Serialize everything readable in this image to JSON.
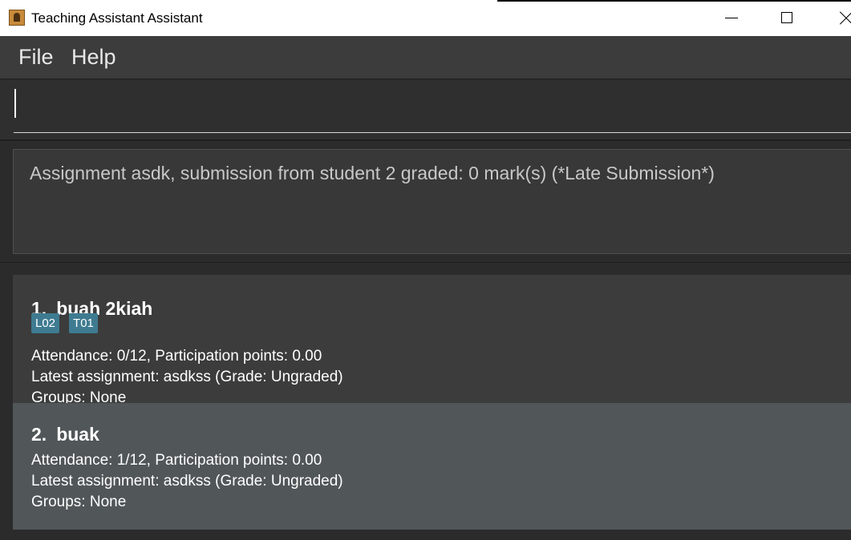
{
  "window": {
    "title": "Teaching Assistant Assistant",
    "icon": "person-icon"
  },
  "menu": {
    "file": "File",
    "help": "Help"
  },
  "command": {
    "value": "",
    "placeholder": ""
  },
  "result": {
    "message": "Assignment asdk, submission from student 2 graded: 0 mark(s) (*Late Submission*)"
  },
  "students": [
    {
      "index": "1.",
      "name": "buah 2kiah",
      "tags": [
        "L02",
        "T01"
      ],
      "attendance": "Attendance: 0/12, Participation points: 0.00",
      "assignment": "Latest assignment: asdkss (Grade: Ungraded)",
      "groups": "Groups: None"
    },
    {
      "index": "2.",
      "name": "buak",
      "tags": [],
      "attendance": "Attendance: 1/12, Participation points: 0.00",
      "assignment": "Latest assignment: asdkss (Grade: Ungraded)",
      "groups": "Groups: None"
    }
  ],
  "colors": {
    "tag_background": "#3e7b91",
    "selected_card": "#515658",
    "card": "#3c3c3c"
  }
}
